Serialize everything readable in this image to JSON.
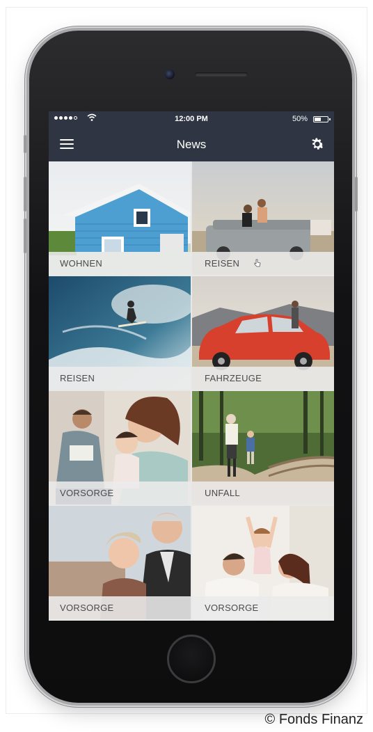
{
  "status_bar": {
    "time": "12:00 PM",
    "battery_percent": "50%",
    "battery_level": 0.5
  },
  "nav": {
    "title": "News",
    "menu_icon": "hamburger-menu-icon",
    "settings_icon": "gear-icon"
  },
  "tiles": [
    {
      "label": "WOHNEN"
    },
    {
      "label": "REISEN"
    },
    {
      "label": "REISEN"
    },
    {
      "label": "FAHRZEUGE"
    },
    {
      "label": "VORSORGE"
    },
    {
      "label": "UNFALL"
    },
    {
      "label": "VORSORGE"
    },
    {
      "label": "VORSORGE"
    }
  ],
  "credit": "© Fonds Finanz",
  "colors": {
    "nav_bar": "#2f3543",
    "label_bg": "#ebebeb",
    "label_text": "#4a4a4a"
  }
}
